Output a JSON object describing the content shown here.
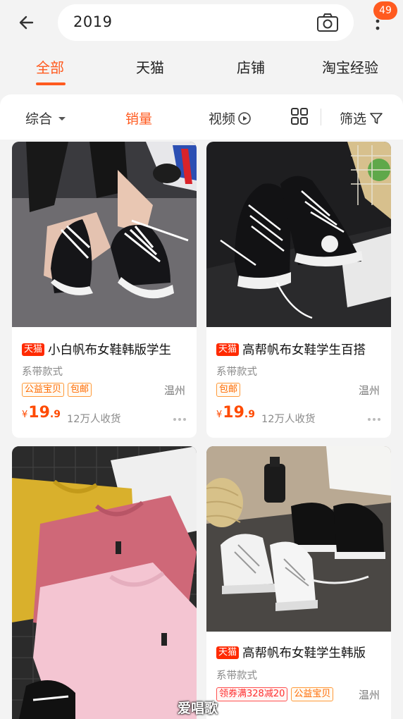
{
  "search": {
    "query": "2019"
  },
  "badge_count": "49",
  "tabs": [
    {
      "label": "全部",
      "active": true
    },
    {
      "label": "天猫"
    },
    {
      "label": "店铺"
    },
    {
      "label": "淘宝经验"
    }
  ],
  "filters": {
    "sort": "综合",
    "sales": "销量",
    "video": "视频",
    "filter": "筛选"
  },
  "colors": {
    "accent": "#ff5a1f",
    "price": "#ff4a00",
    "tmall": "#ff2a00"
  },
  "products": [
    {
      "tag": "天猫",
      "title": "小白帆布女鞋韩版学生",
      "subtitle": "系带款式",
      "tags": [
        "公益宝贝",
        "包邮"
      ],
      "location": "温州",
      "currency": "¥",
      "price_int": "19",
      "price_dec": ".9",
      "sales": "12万人收货"
    },
    {
      "tag": "天猫",
      "title": "高帮帆布女鞋学生百搭",
      "subtitle": "系带款式",
      "tags": [
        "包邮"
      ],
      "location": "温州",
      "currency": "¥",
      "price_int": "19",
      "price_dec": ".9",
      "sales": "12万人收货"
    },
    {
      "tag": "天猫",
      "title": "高帮帆布女鞋学生韩版",
      "subtitle": "系带款式",
      "tags": [
        "领券满328减20",
        "公益宝贝"
      ],
      "location": "温州"
    }
  ],
  "watermark": "爱唱歌"
}
